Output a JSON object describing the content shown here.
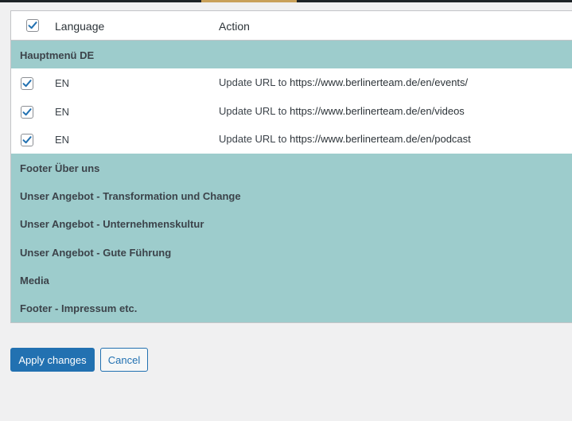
{
  "colors": {
    "group_bg": "#9dcccc",
    "primary": "#2271b1",
    "page_bg": "#f0f0f1",
    "checkbox_check": "#2271b1"
  },
  "header": {
    "select_all_checked": true,
    "language_label": "Language",
    "action_label": "Action"
  },
  "groups": [
    {
      "title": "Hauptmenü DE",
      "rows": [
        {
          "checked": true,
          "language": "EN",
          "action_prefix": "Update URL to",
          "url": "https://www.berlinerteam.de/en/events/"
        },
        {
          "checked": true,
          "language": "EN",
          "action_prefix": "Update URL to",
          "url": "https://www.berlinerteam.de/en/videos"
        },
        {
          "checked": true,
          "language": "EN",
          "action_prefix": "Update URL to",
          "url": "https://www.berlinerteam.de/en/podcast"
        }
      ]
    },
    {
      "title": "Footer Über uns"
    },
    {
      "title": "Unser Angebot - Transformation und Change"
    },
    {
      "title": "Unser Angebot - Unternehmenskultur"
    },
    {
      "title": "Unser Angebot - Gute Führung"
    },
    {
      "title": "Media"
    },
    {
      "title": "Footer - Impressum etc."
    }
  ],
  "buttons": {
    "apply_label": "Apply changes",
    "cancel_label": "Cancel"
  }
}
